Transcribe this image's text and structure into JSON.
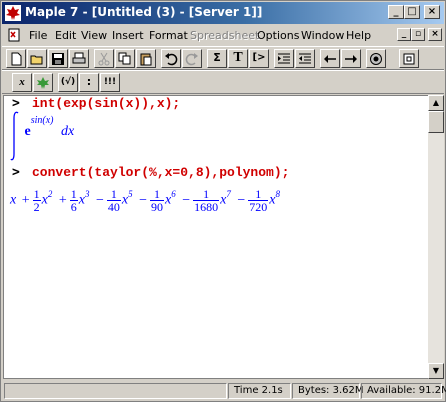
{
  "window": {
    "title": "Maple 7 - [Untitled (3) - [Server 1]]"
  },
  "title_buttons": {
    "minimize": "_",
    "maximize": "□",
    "close": "×"
  },
  "menu": {
    "items": [
      {
        "label": "File"
      },
      {
        "label": "Edit"
      },
      {
        "label": "View"
      },
      {
        "label": "Insert"
      },
      {
        "label": "Format"
      },
      {
        "label": "Spreadsheet",
        "disabled": true
      },
      {
        "label": "Options"
      },
      {
        "label": "Window"
      },
      {
        "label": "Help"
      }
    ],
    "mdi": {
      "minimize": "_",
      "restore": "▫",
      "close": "×"
    }
  },
  "toolbar": {
    "sigma": "Σ",
    "text": "T",
    "exec": "[>",
    "x": "x",
    "fun": "(√)",
    "colon": ":",
    "stop": "!!!"
  },
  "worksheet": {
    "prompt": ">",
    "input1": "int(exp(sin(x)),x);",
    "output1": {
      "integrand_base": "e",
      "integrand_exp": "sin(x)",
      "differential": "dx"
    },
    "input2": "convert(taylor(%,x=0,8),polynom);",
    "output2": {
      "terms": [
        {
          "sign": "",
          "num": "",
          "den": "",
          "pow": ""
        },
        {
          "sign": "+",
          "num": "1",
          "den": "2",
          "pow": "2"
        },
        {
          "sign": "+",
          "num": "1",
          "den": "6",
          "pow": "3"
        },
        {
          "sign": "−",
          "num": "1",
          "den": "40",
          "pow": "5"
        },
        {
          "sign": "−",
          "num": "1",
          "den": "90",
          "pow": "6"
        },
        {
          "sign": "−",
          "num": "1",
          "den": "1680",
          "pow": "7"
        },
        {
          "sign": "−",
          "num": "1",
          "den": "720",
          "pow": "8"
        }
      ],
      "var": "x"
    }
  },
  "scrollbar": {
    "up": "▲",
    "down": "▼"
  },
  "status": {
    "time": "Time  2.1s",
    "bytes": "Bytes: 3.62M",
    "available": "Available: 91.2M"
  }
}
